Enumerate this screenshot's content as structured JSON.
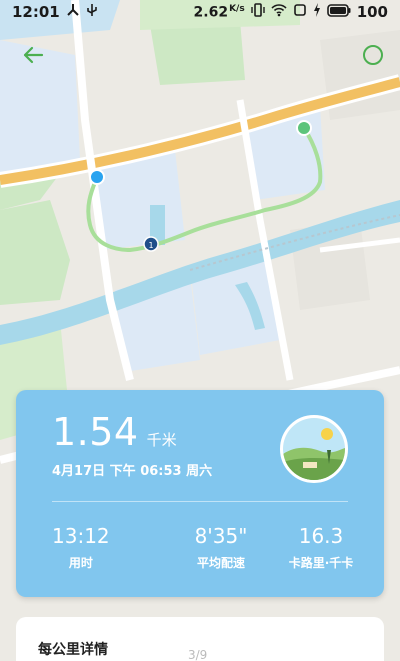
{
  "status_bar": {
    "time": "12:01",
    "speed": "2.62",
    "speed_unit": "K/s",
    "battery": "100",
    "icons": [
      "usb-debug-icon",
      "usb-icon",
      "vibrate-icon",
      "wifi-icon",
      "screen-icon",
      "charging-icon",
      "battery-icon"
    ]
  },
  "header": {
    "back_icon": "arrow-left-icon",
    "share_icon": "circle-icon",
    "accent_color": "#4caf50"
  },
  "map": {
    "route_color": "#a8df9a",
    "start_marker_color": "#29a3f0",
    "end_marker_color": "#5dc47b",
    "km_marker": "1",
    "km_marker_color": "#1f4f8a",
    "water_color": "#a7d8ea",
    "highway_color": "#f2c062"
  },
  "summary": {
    "distance": "1.54",
    "distance_unit": "千米",
    "datetime": "4月17日 下午 06:53 周六",
    "card_color": "#81c6ee",
    "stats": [
      {
        "value": "13:12",
        "label": "用时"
      },
      {
        "value": "8'35\"",
        "label": "平均配速"
      },
      {
        "value": "16.3",
        "label": "卡路里·千卡"
      }
    ]
  },
  "details": {
    "title": "每公里详情",
    "pager": "3/9"
  }
}
